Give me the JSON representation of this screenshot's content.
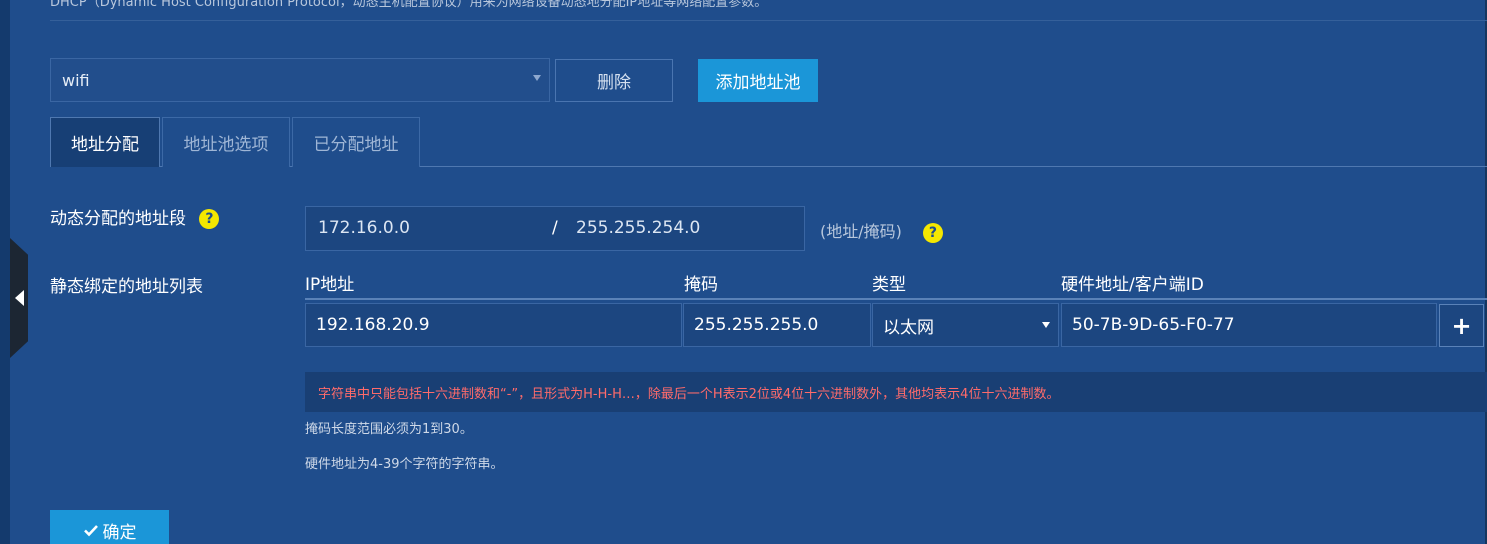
{
  "header": {
    "description": "DHCP（Dynamic Host Configuration Protocol，动态主机配置协议）用来为网络设备动态地分配IP地址等网络配置参数。"
  },
  "pool": {
    "selected": "wifi",
    "delete_label": "删除",
    "add_label": "添加地址池"
  },
  "tabs": [
    {
      "label": "地址分配",
      "active": true
    },
    {
      "label": "地址池选项",
      "active": false
    },
    {
      "label": "已分配地址",
      "active": false
    }
  ],
  "dynamic": {
    "label": "动态分配的地址段",
    "ip": "172.16.0.0",
    "separator": "/",
    "mask": "255.255.254.0",
    "hint": "(地址/掩码)"
  },
  "static": {
    "label": "静态绑定的地址列表",
    "columns": [
      "IP地址",
      "掩码",
      "类型",
      "硬件地址/客户端ID"
    ],
    "rows": [
      {
        "ip": "192.168.20.9",
        "mask": "255.255.255.0",
        "type": "以太网",
        "hw": "50-7B-9D-65-F0-77"
      }
    ],
    "add_symbol": "+"
  },
  "notices": {
    "error": "字符串中只能包括十六进制数和“-”，且形式为H-H-H…，除最后一个H表示2位或4位十六进制数外，其他均表示4位十六进制数。",
    "mask_note": "掩码长度范围必须为1到30。",
    "hw_note": "硬件地址为4-39个字符的字符串。"
  },
  "actions": {
    "ok_label": "确定"
  },
  "colors": {
    "background": "#1f4d8c",
    "accent": "#1b96d8",
    "error": "#ff6b6b",
    "help": "#f5e800"
  }
}
